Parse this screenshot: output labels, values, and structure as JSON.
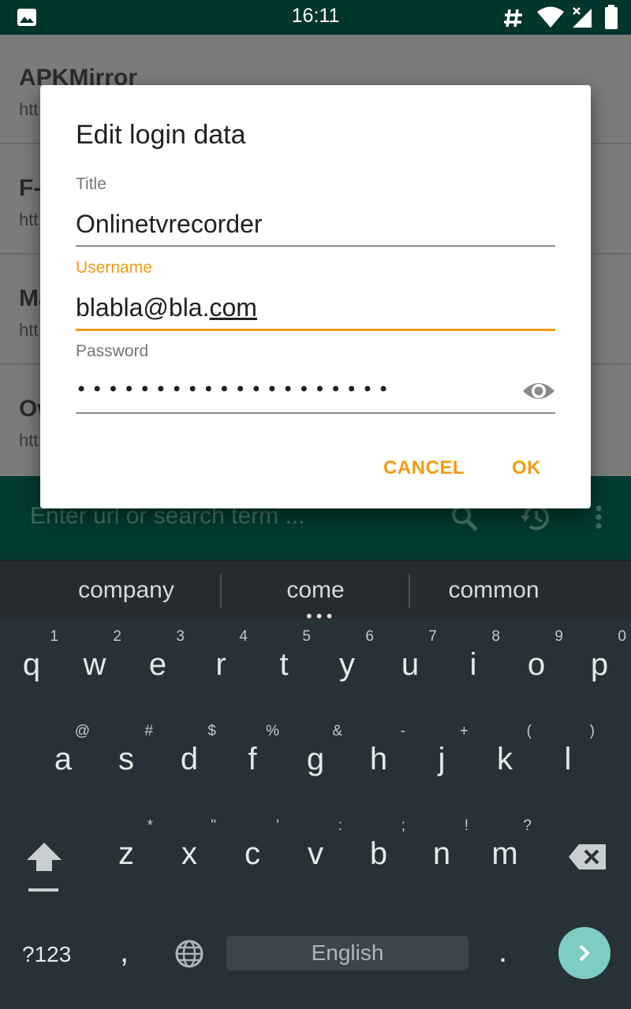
{
  "status_bar": {
    "time": "16:11",
    "icons": [
      "image-notification-icon",
      "hash-icon",
      "wifi-icon",
      "cell-signal-icon",
      "battery-icon"
    ]
  },
  "background_app": {
    "items": [
      {
        "title": "APKMirror",
        "url": "htt"
      },
      {
        "title": "F-",
        "url": "htt"
      },
      {
        "title": "Ma",
        "url": "htt"
      },
      {
        "title": "Ow",
        "url": "htt"
      }
    ],
    "search_placeholder": "Enter url or search term ...",
    "icons": [
      "search-icon",
      "history-icon",
      "more-vert-icon"
    ]
  },
  "dialog": {
    "title": "Edit login data",
    "title_field": {
      "label": "Title",
      "value": "Onlinetvrecorder"
    },
    "username_field": {
      "label": "Username",
      "value_prefix": "blabla@bla.",
      "value_underlined": "com"
    },
    "password_field": {
      "label": "Password",
      "masked": "••••••••••••••••••••"
    },
    "cancel_label": "CANCEL",
    "ok_label": "OK",
    "accent_color": "#f39c12"
  },
  "keyboard": {
    "suggestions": [
      "company",
      "come",
      "common"
    ],
    "rows": [
      [
        {
          "k": "q",
          "h": "1"
        },
        {
          "k": "w",
          "h": "2"
        },
        {
          "k": "e",
          "h": "3"
        },
        {
          "k": "r",
          "h": "4"
        },
        {
          "k": "t",
          "h": "5"
        },
        {
          "k": "y",
          "h": "6"
        },
        {
          "k": "u",
          "h": "7"
        },
        {
          "k": "i",
          "h": "8"
        },
        {
          "k": "o",
          "h": "9"
        },
        {
          "k": "p",
          "h": "0"
        }
      ],
      [
        {
          "k": "a",
          "h": "@"
        },
        {
          "k": "s",
          "h": "#"
        },
        {
          "k": "d",
          "h": "$"
        },
        {
          "k": "f",
          "h": "%"
        },
        {
          "k": "g",
          "h": "&"
        },
        {
          "k": "h",
          "h": "-"
        },
        {
          "k": "j",
          "h": "+"
        },
        {
          "k": "k",
          "h": "("
        },
        {
          "k": "l",
          "h": ")"
        }
      ],
      [
        {
          "k": "z",
          "h": "*"
        },
        {
          "k": "x",
          "h": "\""
        },
        {
          "k": "c",
          "h": "'"
        },
        {
          "k": "v",
          "h": ":"
        },
        {
          "k": "b",
          "h": ";"
        },
        {
          "k": "n",
          "h": "!"
        },
        {
          "k": "m",
          "h": "?"
        }
      ]
    ],
    "symbols_label": "?123",
    "comma_label": ",",
    "period_label": ".",
    "space_label": "English"
  }
}
